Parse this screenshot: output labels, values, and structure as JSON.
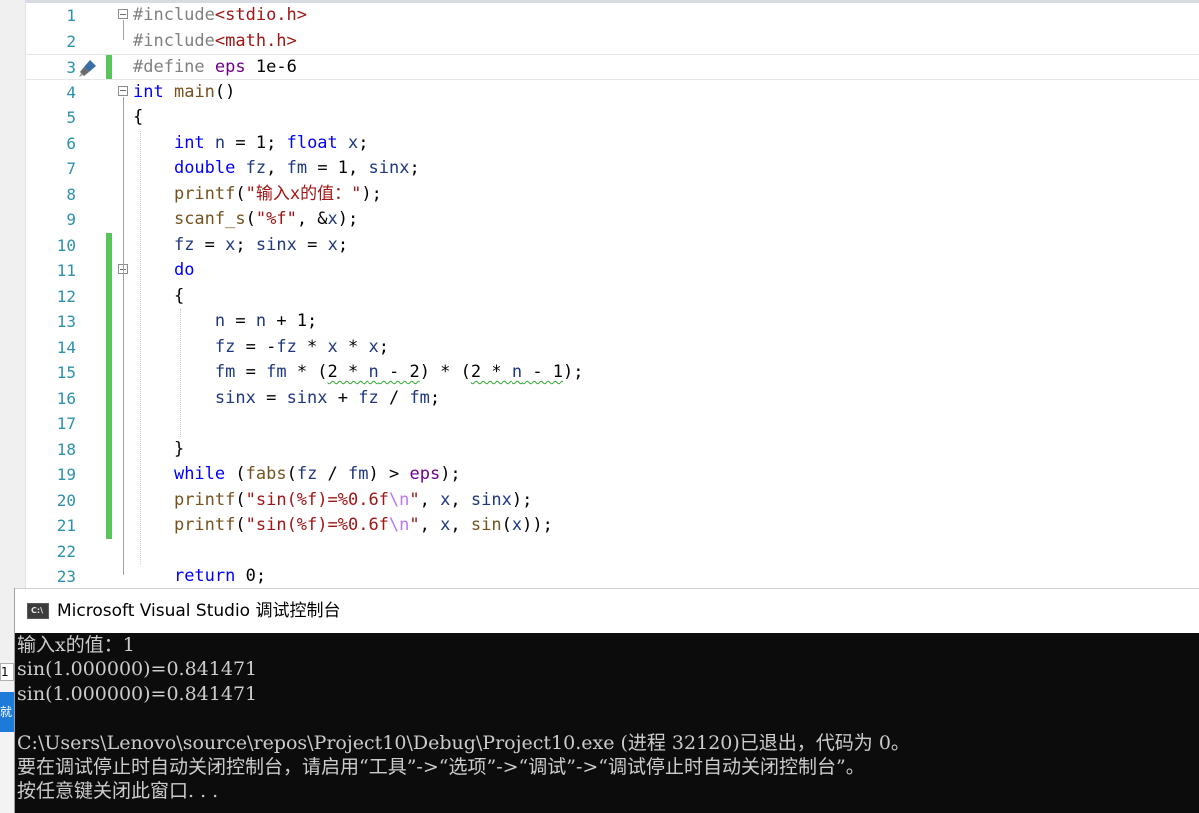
{
  "editor": {
    "lines": [
      {
        "n": "1",
        "html": "<span class=\"pp\">#include</span><span class=\"str\">&lt;stdio.h&gt;</span>"
      },
      {
        "n": "2",
        "html": "<span class=\"pp\">#include</span><span class=\"str\">&lt;math.h&gt;</span>"
      },
      {
        "n": "3",
        "html": "<span class=\"pp\">#define</span> <span class=\"mac\">eps</span> 1e-6"
      },
      {
        "n": "4",
        "html": "<span class=\"kw\">int</span> <span class=\"fn\">main</span>()"
      },
      {
        "n": "5",
        "html": "{"
      },
      {
        "n": "6",
        "html": "    <span class=\"kw\">int</span> <span class=\"var\">n</span> = 1; <span class=\"kw\">float</span> <span class=\"var\">x</span>;"
      },
      {
        "n": "7",
        "html": "    <span class=\"kw\">double</span> <span class=\"var\">fz</span>, <span class=\"var\">fm</span> = 1, <span class=\"var\">sinx</span>;"
      },
      {
        "n": "8",
        "html": "    <span class=\"fn\">printf</span>(<span class=\"str\">\"输入x的值：\"</span>);"
      },
      {
        "n": "9",
        "html": "    <span class=\"fn\">scanf_s</span>(<span class=\"str\">\"%f\"</span>, &amp;<span class=\"var\">x</span>);"
      },
      {
        "n": "10",
        "html": "    <span class=\"var\">fz</span> = <span class=\"var\">x</span>; <span class=\"var\">sinx</span> = <span class=\"var\">x</span>;"
      },
      {
        "n": "11",
        "html": "    <span class=\"kw\">do</span>"
      },
      {
        "n": "12",
        "html": "    {"
      },
      {
        "n": "13",
        "html": "        <span class=\"var\">n</span> = <span class=\"var\">n</span> + 1;"
      },
      {
        "n": "14",
        "html": "        <span class=\"var\">fz</span> = -<span class=\"var\">fz</span> * <span class=\"var\">x</span> * <span class=\"var\">x</span>;"
      },
      {
        "n": "15",
        "html": "        <span class=\"var\">fm</span> = <span class=\"var\">fm</span> * (<span class=\"squig\">2 * <span class=\"var\">n</span> - 2</span>) * (<span class=\"squig\">2 * <span class=\"var\">n</span> - 1</span>);"
      },
      {
        "n": "16",
        "html": "        <span class=\"var\">sinx</span> = <span class=\"var\">sinx</span> + <span class=\"var\">fz</span> / <span class=\"var\">fm</span>;"
      },
      {
        "n": "17",
        "html": ""
      },
      {
        "n": "18",
        "html": "    }"
      },
      {
        "n": "19",
        "html": "    <span class=\"kw\">while</span> (<span class=\"fn\">fabs</span>(<span class=\"var\">fz</span> / <span class=\"var\">fm</span>) &gt; <span class=\"mac\">eps</span>);"
      },
      {
        "n": "20",
        "html": "    <span class=\"fn\">printf</span>(<span class=\"str\">\"sin(%f)=%0.6f<span class=\"esc\">\\n</span>\"</span>, <span class=\"var\">x</span>, <span class=\"var\">sinx</span>);"
      },
      {
        "n": "21",
        "html": "    <span class=\"fn\">printf</span>(<span class=\"str\">\"sin(%f)=%0.6f<span class=\"esc\">\\n</span>\"</span>, <span class=\"var\">x</span>, <span class=\"fn\">sin</span>(<span class=\"var\">x</span>));"
      },
      {
        "n": "22",
        "html": ""
      },
      {
        "n": "23",
        "html": "    <span class=\"kw\">return</span> 0;"
      }
    ],
    "changed_lines": [
      "3",
      "10",
      "11",
      "12",
      "13",
      "14",
      "15",
      "16",
      "17",
      "18",
      "19",
      "20",
      "21"
    ],
    "fold_lines": [
      "1",
      "4",
      "11"
    ],
    "current_line": "3",
    "colors": {
      "keyword": "#0000ff",
      "preprocessor": "#808080",
      "string": "#a31515",
      "macro": "#6f008a",
      "function": "#74531f",
      "variable": "#1f377f",
      "line_number": "#2b91af",
      "change_bar": "#57c55b"
    }
  },
  "console": {
    "icon_text": "C:\\",
    "title": "Microsoft Visual Studio 调试控制台",
    "lines": [
      "输入x的值：1",
      "sin(1.000000)=0.841471",
      "sin(1.000000)=0.841471",
      "",
      "C:\\Users\\Lenovo\\source\\repos\\Project10\\Debug\\Project10.exe (进程 32120)已退出，代码为 0。",
      "要在调试停止时自动关闭控制台，请启用“工具”->“选项”->“调试”->“调试停止时自动关闭控制台”。",
      "按任意键关闭此窗口. . ."
    ]
  },
  "background_window": {
    "tab_text": "1",
    "status_text": "就绪"
  }
}
